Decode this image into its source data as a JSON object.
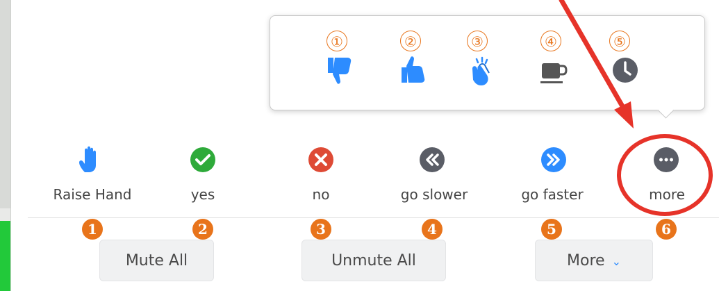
{
  "popup": {
    "items": [
      {
        "number": "①",
        "icon": "thumbs-down-icon",
        "color": "#2d8cff"
      },
      {
        "number": "②",
        "icon": "thumbs-up-icon",
        "color": "#2d8cff"
      },
      {
        "number": "③",
        "icon": "clap-icon",
        "color": "#2d8cff"
      },
      {
        "number": "④",
        "icon": "coffee-icon",
        "color": "#555555"
      },
      {
        "number": "⑤",
        "icon": "clock-icon",
        "color": "#5a5d66"
      }
    ]
  },
  "feedback": {
    "items": [
      {
        "label": "Raise Hand",
        "number": "1",
        "icon": "raise-hand-icon",
        "color": "#2d8cff"
      },
      {
        "label": "yes",
        "number": "2",
        "icon": "check-icon",
        "color": "#2eaa3a"
      },
      {
        "label": "no",
        "number": "3",
        "icon": "x-icon",
        "color": "#de4a35"
      },
      {
        "label": "go slower",
        "number": "4",
        "icon": "rewind-icon",
        "color": "#5a5d66"
      },
      {
        "label": "go faster",
        "number": "5",
        "icon": "fast-forward-icon",
        "color": "#2d8cff"
      },
      {
        "label": "more",
        "number": "6",
        "icon": "more-icon",
        "color": "#5a5d66"
      }
    ]
  },
  "buttons": {
    "mute_all": "Mute All",
    "unmute_all": "Unmute All",
    "more": "More",
    "more_chevron": "⌄"
  },
  "colors": {
    "annotation_orange": "#e8741b",
    "highlight_red": "#e63329",
    "accent_blue": "#2d8cff"
  }
}
